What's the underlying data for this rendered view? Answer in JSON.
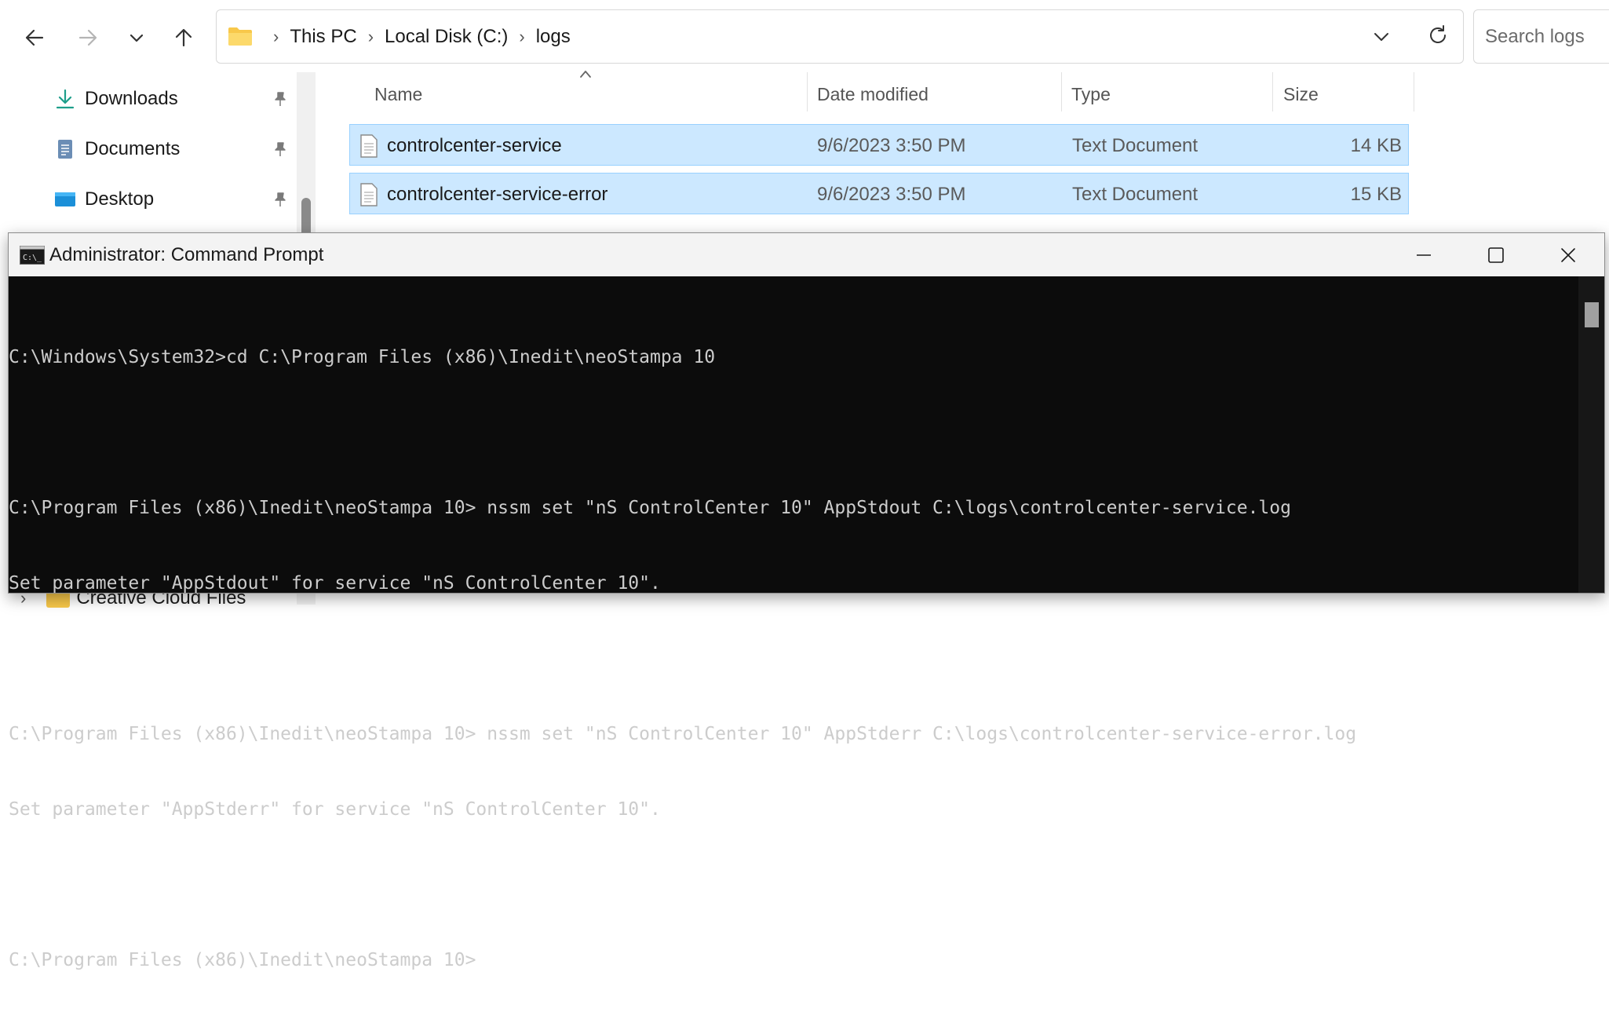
{
  "explorer": {
    "breadcrumb": [
      "This PC",
      "Local Disk (C:)",
      "logs"
    ],
    "search_placeholder": "Search logs",
    "sidebar": {
      "items": [
        {
          "label": "Downloads",
          "icon": "download-icon",
          "pinned": true
        },
        {
          "label": "Documents",
          "icon": "documents-icon",
          "pinned": true
        },
        {
          "label": "Desktop",
          "icon": "desktop-icon",
          "pinned": true
        }
      ],
      "bottom_item": "Creative Cloud Files"
    },
    "columns": {
      "name": "Name",
      "date": "Date modified",
      "type": "Type",
      "size": "Size"
    },
    "files": [
      {
        "name": "controlcenter-service",
        "date": "9/6/2023 3:50 PM",
        "type": "Text Document",
        "size": "14 KB",
        "selected": true
      },
      {
        "name": "controlcenter-service-error",
        "date": "9/6/2023 3:50 PM",
        "type": "Text Document",
        "size": "15 KB",
        "selected": true
      }
    ],
    "colors": {
      "selection_bg": "#cce8ff",
      "selection_border": "#99d1ff",
      "folder": "#f8c84a"
    }
  },
  "cmd": {
    "title": "Administrator: Command Prompt",
    "lines": [
      "C:\\Windows\\System32>cd C:\\Program Files (x86)\\Inedit\\neoStampa 10",
      "",
      "C:\\Program Files (x86)\\Inedit\\neoStampa 10> nssm set \"nS ControlCenter 10\" AppStdout C:\\logs\\controlcenter-service.log",
      "Set parameter \"AppStdout\" for service \"nS ControlCenter 10\".",
      "",
      "C:\\Program Files (x86)\\Inedit\\neoStampa 10> nssm set \"nS ControlCenter 10\" AppStderr C:\\logs\\controlcenter-service-error.log",
      "Set parameter \"AppStderr\" for service \"nS ControlCenter 10\".",
      "",
      "C:\\Program Files (x86)\\Inedit\\neoStampa 10>"
    ],
    "colors": {
      "background": "#0c0c0c",
      "text": "#cccccc",
      "titlebar": "#f3f3f3"
    }
  }
}
